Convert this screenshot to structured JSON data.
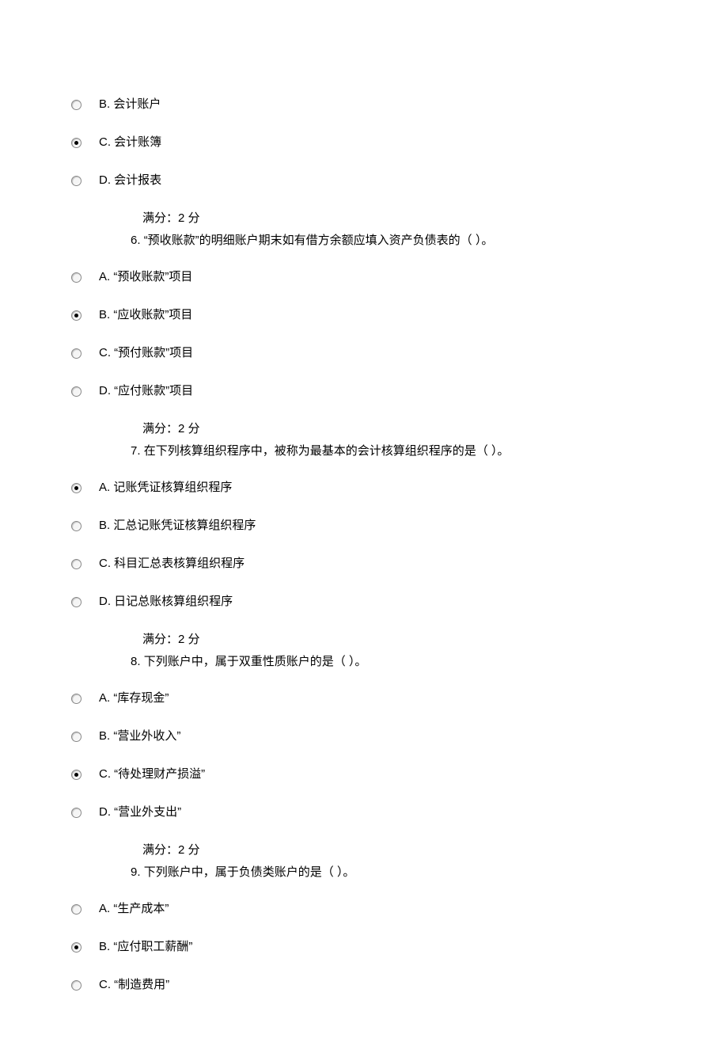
{
  "questions": [
    {
      "number": null,
      "text": null,
      "score": null,
      "options": [
        {
          "label": "B. 会计账户",
          "selected": false
        },
        {
          "label": "C. 会计账簿",
          "selected": true
        },
        {
          "label": "D. 会计报表",
          "selected": false
        }
      ]
    },
    {
      "number": "6.",
      "text": "“预收账款”的明细账户期末如有借方余额应填入资产负债表的（  ）。",
      "score": "满分：2 分",
      "options": [
        {
          "label": "A. “预收账款”项目",
          "selected": false
        },
        {
          "label": "B. “应收账款”项目",
          "selected": true
        },
        {
          "label": "C. “预付账款”项目",
          "selected": false
        },
        {
          "label": "D. “应付账款”项目",
          "selected": false
        }
      ]
    },
    {
      "number": "7.",
      "text": "在下列核算组织程序中，被称为最基本的会计核算组织程序的是（  ）。",
      "score": "满分：2 分",
      "options": [
        {
          "label": "A. 记账凭证核算组织程序",
          "selected": true
        },
        {
          "label": "B. 汇总记账凭证核算组织程序",
          "selected": false
        },
        {
          "label": "C. 科目汇总表核算组织程序",
          "selected": false
        },
        {
          "label": "D. 日记总账核算组织程序",
          "selected": false
        }
      ]
    },
    {
      "number": "8.",
      "text": "下列账户中，属于双重性质账户的是（  ）。",
      "score": "满分：2 分",
      "options": [
        {
          "label": "A. “库存现金”",
          "selected": false
        },
        {
          "label": "B. “营业外收入”",
          "selected": false
        },
        {
          "label": "C. “待处理财产损溢”",
          "selected": true
        },
        {
          "label": "D. “营业外支出”",
          "selected": false
        }
      ]
    },
    {
      "number": "9.",
      "text": "下列账户中，属于负债类账户的是（  ）。",
      "score": "满分：2 分",
      "options": [
        {
          "label": "A. “生产成本”",
          "selected": false
        },
        {
          "label": "B. “应付职工薪酬”",
          "selected": true
        },
        {
          "label": "C. “制造费用”",
          "selected": false
        }
      ]
    }
  ]
}
